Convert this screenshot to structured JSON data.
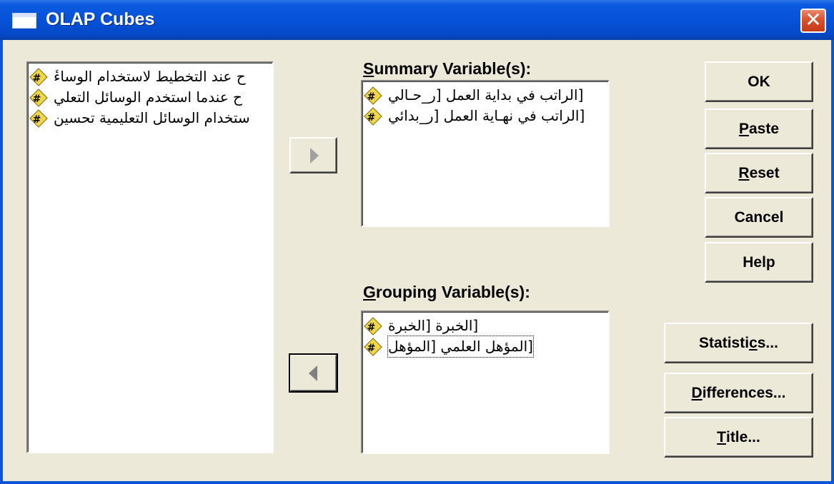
{
  "window": {
    "title": "OLAP Cubes",
    "close_glyph": "✕"
  },
  "source_list": {
    "items": [
      {
        "label": "ح عند التخطيط لاستخدام الوساءٔ",
        "icon": "scale-variable-icon"
      },
      {
        "label": "ح عندما استخدم الوسائل التعلي",
        "icon": "scale-variable-icon"
      },
      {
        "label": "ستخدام الوسائل التعليمية تحسين",
        "icon": "scale-variable-icon"
      }
    ]
  },
  "summary": {
    "label_prefix": "S",
    "label_rest": "ummary Variable(s):",
    "items": [
      {
        "label": "[الراتب في بداية العمل [ر_حـالي",
        "icon": "scale-variable-icon"
      },
      {
        "label": "[الراتب في نهـاية العمل [ر_بدائي",
        "icon": "scale-variable-icon"
      }
    ]
  },
  "grouping": {
    "label_prefix": "G",
    "label_rest": "rouping Variable(s):",
    "items": [
      {
        "label": "[الخبرة [الخبرة",
        "icon": "scale-variable-icon"
      },
      {
        "label": "[المؤهل العلمي [المؤهل",
        "icon": "scale-variable-icon"
      }
    ]
  },
  "buttons": {
    "ok": "OK",
    "paste_ul": "P",
    "paste_rest": "aste",
    "reset_ul": "R",
    "reset_rest": "eset",
    "cancel": "Cancel",
    "help": "Help",
    "statistics_pre": "Statisti",
    "statistics_ul": "c",
    "statistics_post": "s...",
    "differences_ul": "D",
    "differences_rest": "ifferences...",
    "title_ul": "T",
    "title_rest": "itle..."
  },
  "colors": {
    "dialog_bg": "#ece9d8",
    "titlebar": "#0652d8",
    "close_button": "#d8512f"
  }
}
